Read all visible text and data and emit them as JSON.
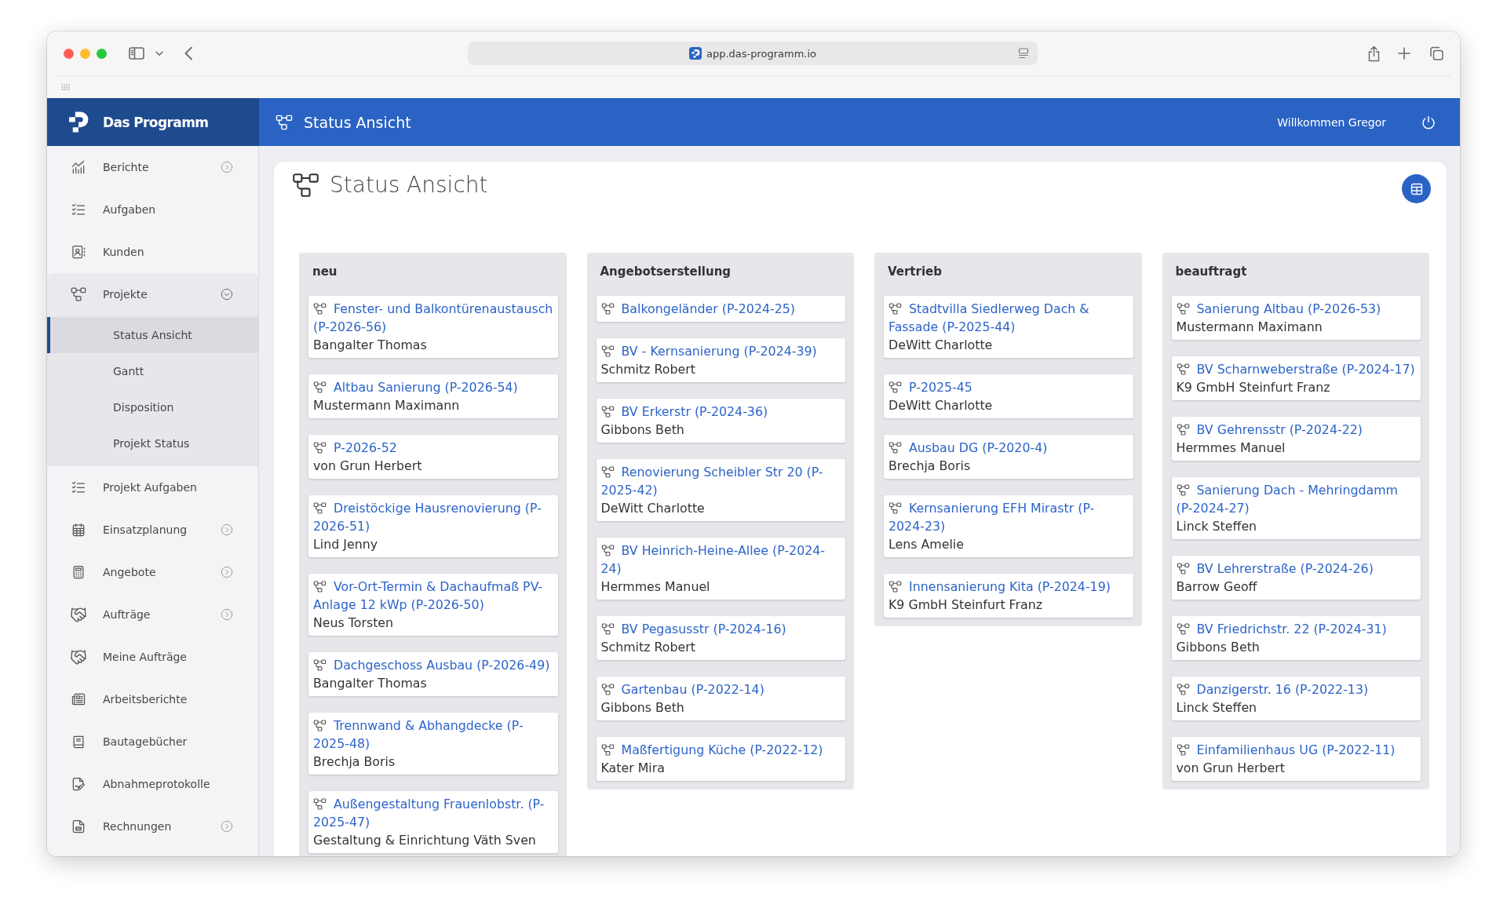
{
  "browser": {
    "url": "app.das-programm.io"
  },
  "header": {
    "logo": "Das Programm",
    "title": "Status Ansicht",
    "greeting": "Willkommen Gregor"
  },
  "sidebar": {
    "items": [
      {
        "label": "Berichte",
        "selected": false,
        "expanded": false
      },
      {
        "label": "Aufgaben",
        "selected": false
      },
      {
        "label": "Kunden",
        "selected": false
      },
      {
        "label": "Projekte",
        "selected": false,
        "expanded": true,
        "children": [
          {
            "label": "Status Ansicht",
            "selected": true
          },
          {
            "label": "Gantt",
            "selected": false
          },
          {
            "label": "Disposition",
            "selected": false
          },
          {
            "label": "Projekt Status",
            "selected": false
          }
        ]
      },
      {
        "label": "Projekt Aufgaben",
        "selected": false
      },
      {
        "label": "Einsatzplanung",
        "selected": false,
        "expanded": false
      },
      {
        "label": "Angebote",
        "selected": false,
        "expanded": false
      },
      {
        "label": "Aufträge",
        "selected": false,
        "expanded": false
      },
      {
        "label": "Meine Aufträge",
        "selected": false
      },
      {
        "label": "Arbeitsberichte",
        "selected": false
      },
      {
        "label": "Bautagebücher",
        "selected": false
      },
      {
        "label": "Abnahmeprotokolle",
        "selected": false
      },
      {
        "label": "Rechnungen",
        "selected": false,
        "expanded": false
      }
    ]
  },
  "page": {
    "title": "Status Ansicht"
  },
  "board": {
    "columns": [
      {
        "title": "neu",
        "cards": [
          {
            "title": "Fenster- und Balkontürenaustausch (P-2026-56)",
            "person": "Bangalter Thomas"
          },
          {
            "title": "Altbau Sanierung (P-2026-54)",
            "person": "Mustermann Maximann"
          },
          {
            "title": "P-2026-52",
            "person": "von Grun Herbert"
          },
          {
            "title": "Dreistöckige Hausrenovierung (P-2026-51)",
            "person": "Lind Jenny"
          },
          {
            "title": "Vor-Ort-Termin & Dachaufmaß PV-Anlage 12 kWp (P-2026-50)",
            "person": "Neus Torsten"
          },
          {
            "title": "Dachgeschoss Ausbau (P-2026-49)",
            "person": "Bangalter Thomas"
          },
          {
            "title": "Trennwand & Abhangdecke (P-2025-48)",
            "person": "Brechja Boris"
          },
          {
            "title": "Außengestaltung Frauenlobstr. (P-2025-47)",
            "person": "Gestaltung & Einrichtung Väth Sven"
          }
        ]
      },
      {
        "title": "Angebotserstellung",
        "cards": [
          {
            "title": "Balkongeländer (P-2024-25)"
          },
          {
            "title": "BV - Kernsanierung (P-2024-39)",
            "person": "Schmitz Robert"
          },
          {
            "title": "BV Erkerstr (P-2024-36)",
            "person": "Gibbons Beth"
          },
          {
            "title": "Renovierung Scheibler Str 20 (P-2025-42)",
            "person": "DeWitt Charlotte"
          },
          {
            "title": "BV Heinrich-Heine-Allee (P-2024-24)",
            "person": "Hermmes Manuel"
          },
          {
            "title": "BV Pegasusstr (P-2024-16)",
            "person": "Schmitz Robert"
          },
          {
            "title": "Gartenbau (P-2022-14)",
            "person": "Gibbons Beth"
          },
          {
            "title": "Maßfertigung Küche (P-2022-12)",
            "person": "Kater Mira"
          }
        ]
      },
      {
        "title": "Vertrieb",
        "cards": [
          {
            "title": "Stadtvilla Siedlerweg Dach & Fassade (P-2025-44)",
            "person": "DeWitt Charlotte"
          },
          {
            "title": "P-2025-45",
            "person": "DeWitt Charlotte"
          },
          {
            "title": "Ausbau DG (P-2020-4)",
            "person": "Brechja Boris"
          },
          {
            "title": "Kernsanierung EFH Mirastr (P-2024-23)",
            "person": "Lens Amelie"
          },
          {
            "title": "Innensanierung Kita (P-2024-19)",
            "person": "K9 GmbH Steinfurt Franz"
          }
        ]
      },
      {
        "title": "beauftragt",
        "cards": [
          {
            "title": "Sanierung Altbau (P-2026-53)",
            "person": "Mustermann Maximann"
          },
          {
            "title": "BV Scharnweberstraße (P-2024-17)",
            "person": "K9 GmbH Steinfurt Franz"
          },
          {
            "title": "BV Gehrensstr (P-2024-22)",
            "person": "Hermmes Manuel"
          },
          {
            "title": "Sanierung Dach - Mehringdamm (P-2024-27)",
            "person": "Linck Steffen"
          },
          {
            "title": "BV Lehrerstraße (P-2024-26)",
            "person": "Barrow Geoff"
          },
          {
            "title": "BV Friedrichstr. 22 (P-2024-31)",
            "person": "Gibbons Beth"
          },
          {
            "title": "Danzigerstr. 16 (P-2022-13)",
            "person": "Linck Steffen"
          },
          {
            "title": "Einfamilienhaus UG (P-2022-11)",
            "person": "von Grun Herbert"
          }
        ]
      }
    ]
  }
}
